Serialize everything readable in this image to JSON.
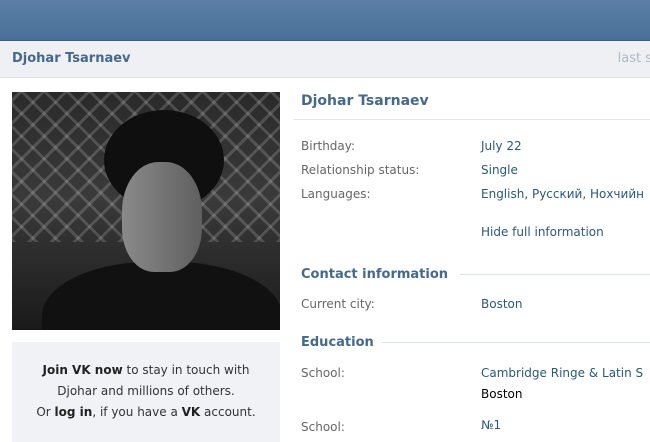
{
  "header": {
    "name": "Djohar Tsarnaev",
    "last_seen": "last s"
  },
  "profile": {
    "title": "Djohar Tsarnaev",
    "fields": [
      {
        "label": "Birthday:",
        "value": "July 22"
      },
      {
        "label": "Relationship status:",
        "value": "Single"
      },
      {
        "label": "Languages:",
        "value": "English, Русский, Нохчийн"
      }
    ],
    "hide_link": "Hide full information",
    "contact_section": "Contact information",
    "current_city_label": "Current city:",
    "current_city_value": "Boston",
    "education_section": "Education",
    "schools": [
      {
        "label": "School:",
        "value": "Cambridge Ringe & Latin S",
        "city": "Boston"
      },
      {
        "label": "School:",
        "value": "№1"
      }
    ]
  },
  "join_box": {
    "join_link": "Join VK now",
    "line1_rest": " to stay in touch with",
    "line2": "Djohar and millions of others.",
    "line3_prefix": "Or ",
    "login_link": "log in",
    "line3_middle": ", if you have a ",
    "vk": "VK",
    "line3_suffix": " account."
  }
}
